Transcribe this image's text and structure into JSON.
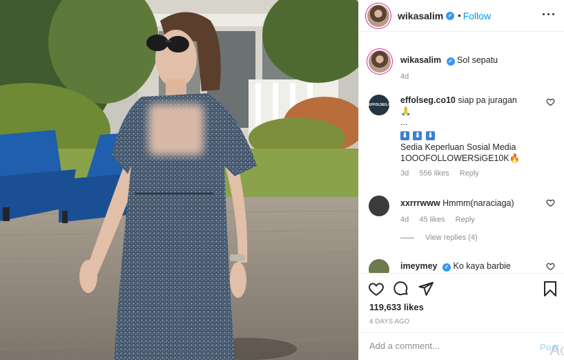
{
  "post": {
    "author": "wikasalim",
    "follow_label": "Follow",
    "dot": "•",
    "more_glyph": "···"
  },
  "caption": {
    "user": "wikasalim",
    "text": "Sol sepatu",
    "age": "4d"
  },
  "comments": [
    {
      "user": "effolseg.co10",
      "line1": "siap pa juragan",
      "emoji1": "🙏",
      "line2": "...",
      "boxes": [
        "⬇",
        "⬇",
        "⬇"
      ],
      "line3": "Sedia Keperluan Sosial Media",
      "line4": "1OOOFOLLOWERSiGE10K🔥",
      "age": "3d",
      "likes": "556 likes",
      "reply": "Reply",
      "avatar_text": "EFFOLSEG.CO"
    },
    {
      "user": "xxrrrwww",
      "text": "Hmmm(naraciaga)",
      "age": "4d",
      "likes": "45 likes",
      "reply": "Reply",
      "view_replies": "View replies (4)"
    },
    {
      "user": "imeymey",
      "text": "Ko kaya barbie"
    }
  ],
  "actions": {
    "likes": "119,633 likes",
    "ago": "4 DAYS AGO"
  },
  "add_comment": {
    "placeholder": "Add a comment...",
    "post_label": "Post",
    "watermark": "Ac"
  },
  "colors": {
    "link_blue": "#0095f6",
    "verified_blue": "#3897f0",
    "muted": "#8e8e8e",
    "text": "#262626"
  }
}
